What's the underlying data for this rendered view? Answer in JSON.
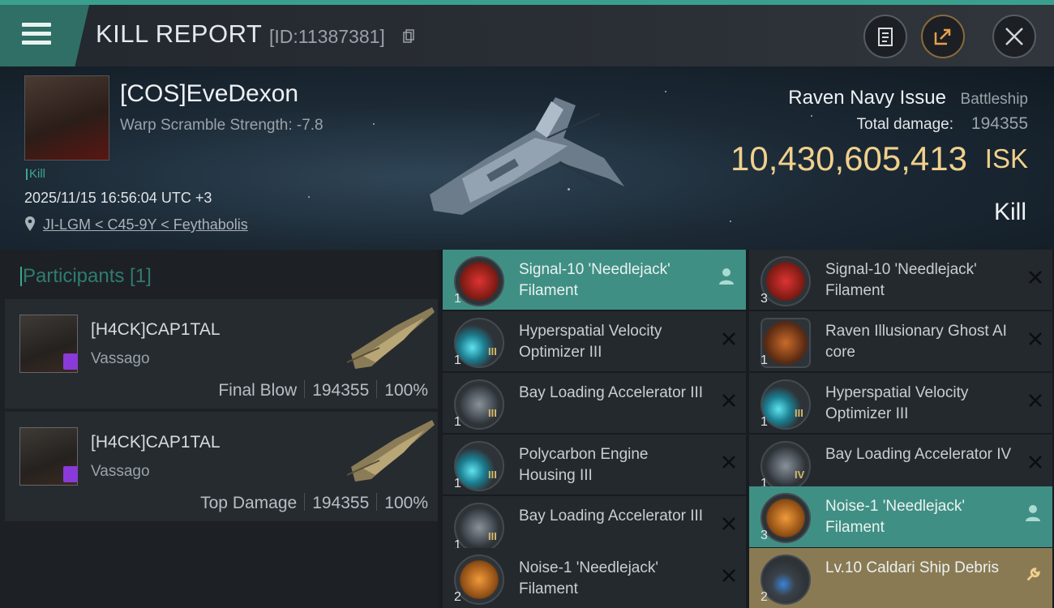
{
  "header": {
    "title": "KILL REPORT",
    "kill_id": "[ID:11387381]",
    "icons": [
      "menu-icon",
      "copy-icon",
      "clipboard-icon",
      "share-icon",
      "close-icon"
    ]
  },
  "victim": {
    "name": "[COS]EveDexon",
    "warp_scramble": "Warp Scramble Strength: -7.8",
    "kill_tag": "Kill",
    "datetime": "2025/11/15 16:56:04 UTC +3",
    "location": "JI-LGM < C45-9Y < Feythabolis"
  },
  "ship": {
    "name": "Raven Navy Issue",
    "class": "Battleship",
    "damage_label": "Total damage:",
    "damage_value": "194355",
    "isk_value": "10,430,605,413",
    "isk_unit": "ISK",
    "result": "Kill"
  },
  "participants": {
    "title": "Participants [1]",
    "list": [
      {
        "name": "[H4CK]CAP1TAL",
        "ship": "Vassago",
        "role": "Final Blow",
        "damage": "194355",
        "percent": "100%"
      },
      {
        "name": "[H4CK]CAP1TAL",
        "ship": "Vassago",
        "role": "Top Damage",
        "damage": "194355",
        "percent": "100%"
      }
    ]
  },
  "items": [
    {
      "name": "Signal-10 'Needlejack' Filament",
      "qty": "1",
      "status": "person",
      "icon": "filament-red-icon",
      "highlight": "green"
    },
    {
      "name": "Signal-10 'Needlejack' Filament",
      "qty": "3",
      "status": "close",
      "icon": "filament-red-icon",
      "highlight": ""
    },
    {
      "name": "Hyperspatial Velocity Optimizer III",
      "qty": "1",
      "status": "close",
      "icon": "rig-cyan-icon",
      "tier": "III",
      "highlight": ""
    },
    {
      "name": "Raven Illusionary Ghost AI core",
      "qty": "1",
      "status": "close",
      "icon": "ai-core-icon",
      "highlight": ""
    },
    {
      "name": "Bay Loading Accelerator III",
      "qty": "1",
      "status": "close",
      "icon": "launcher-rig-icon",
      "tier": "III",
      "highlight": ""
    },
    {
      "name": "Hyperspatial Velocity Optimizer III",
      "qty": "1",
      "status": "close",
      "icon": "rig-cyan-icon",
      "tier": "III",
      "highlight": ""
    },
    {
      "name": "Polycarbon Engine Housing III",
      "qty": "1",
      "status": "close",
      "icon": "rig-cyan-icon",
      "tier": "III",
      "highlight": ""
    },
    {
      "name": "Bay Loading Accelerator IV",
      "qty": "1",
      "status": "close",
      "icon": "launcher-rig-icon",
      "tier": "IV",
      "highlight": ""
    },
    {
      "name": "Bay Loading Accelerator III",
      "qty": "1",
      "status": "close",
      "icon": "launcher-rig-icon",
      "tier": "III",
      "highlight": ""
    },
    {
      "name": "Noise-1 'Needlejack' Filament",
      "qty": "3",
      "status": "person",
      "icon": "filament-orange-icon",
      "highlight": "green"
    },
    {
      "name": "Noise-1 'Needlejack' Filament",
      "qty": "2",
      "status": "close",
      "icon": "filament-orange-icon",
      "highlight": ""
    },
    {
      "name": "Lv.10 Caldari Ship Debris",
      "qty": "2",
      "status": "wrench",
      "icon": "debris-icon",
      "highlight": "gold"
    }
  ]
}
